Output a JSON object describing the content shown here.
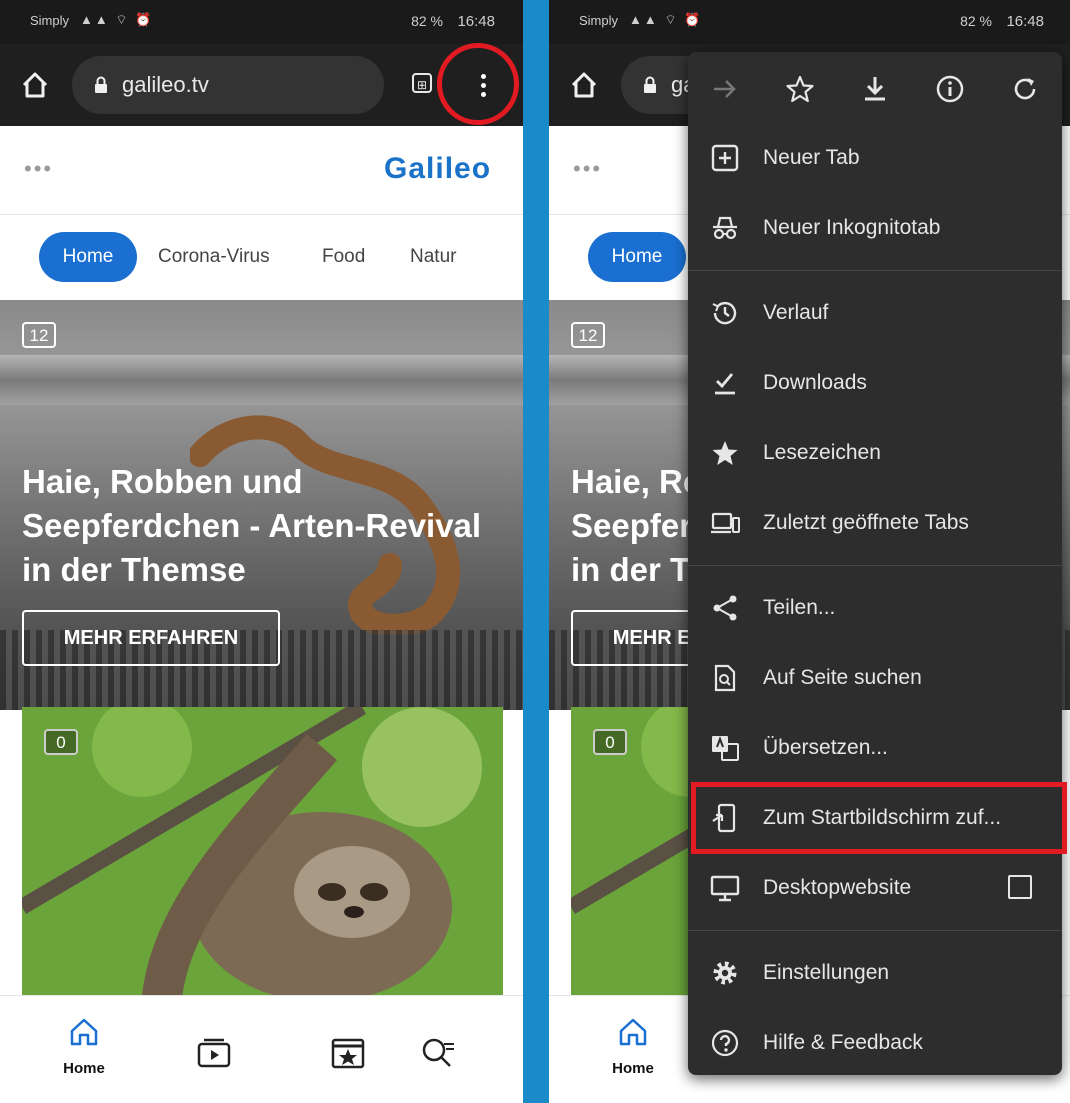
{
  "status_bar": {
    "carrier": "Simply",
    "signal": "▲▲ ⌔ ⏰",
    "battery": "82 %",
    "time": "16:48"
  },
  "browser": {
    "url": "galileo.tv",
    "tab_count": "⊞"
  },
  "site": {
    "header_dots": "•••",
    "logo": "Galileo",
    "nav": [
      "Home",
      "Corona-Virus",
      "Food",
      "Natur"
    ],
    "hero": {
      "age_badge": "12",
      "title": "Haie, Robben und Seepferdchen - Arten-Revival in der Themse",
      "cta": "MEHR ERFAHREN"
    },
    "card": {
      "age_badge": "0"
    },
    "bottom_nav": {
      "home_label": "Home"
    }
  },
  "menu": {
    "toolbar_icons": [
      "forward-icon",
      "star-icon",
      "download-icon",
      "info-icon",
      "reload-icon"
    ],
    "items": [
      {
        "label": "Neuer Tab",
        "icon": "new-tab-icon"
      },
      {
        "label": "Neuer Inkognitotab",
        "icon": "incognito-icon"
      },
      {
        "label": "Verlauf",
        "icon": "history-icon"
      },
      {
        "label": "Downloads",
        "icon": "downloads-icon"
      },
      {
        "label": "Lesezeichen",
        "icon": "bookmark-star-icon"
      },
      {
        "label": "Zuletzt geöffnete Tabs",
        "icon": "recent-tabs-icon"
      },
      {
        "label": "Teilen...",
        "icon": "share-icon"
      },
      {
        "label": "Auf Seite suchen",
        "icon": "find-in-page-icon"
      },
      {
        "label": "Übersetzen...",
        "icon": "translate-icon"
      },
      {
        "label": "Zum Startbildschirm zuf...",
        "icon": "add-to-home-icon"
      },
      {
        "label": "Desktopwebsite",
        "icon": "desktop-icon"
      },
      {
        "label": "Einstellungen",
        "icon": "settings-gear-icon"
      },
      {
        "label": "Hilfe & Feedback",
        "icon": "help-icon"
      }
    ]
  },
  "colors": {
    "accent": "#1a6fd1",
    "highlight": "#e21b23",
    "menu_bg": "#2d2d2d",
    "divider": "#1b8ac9"
  }
}
